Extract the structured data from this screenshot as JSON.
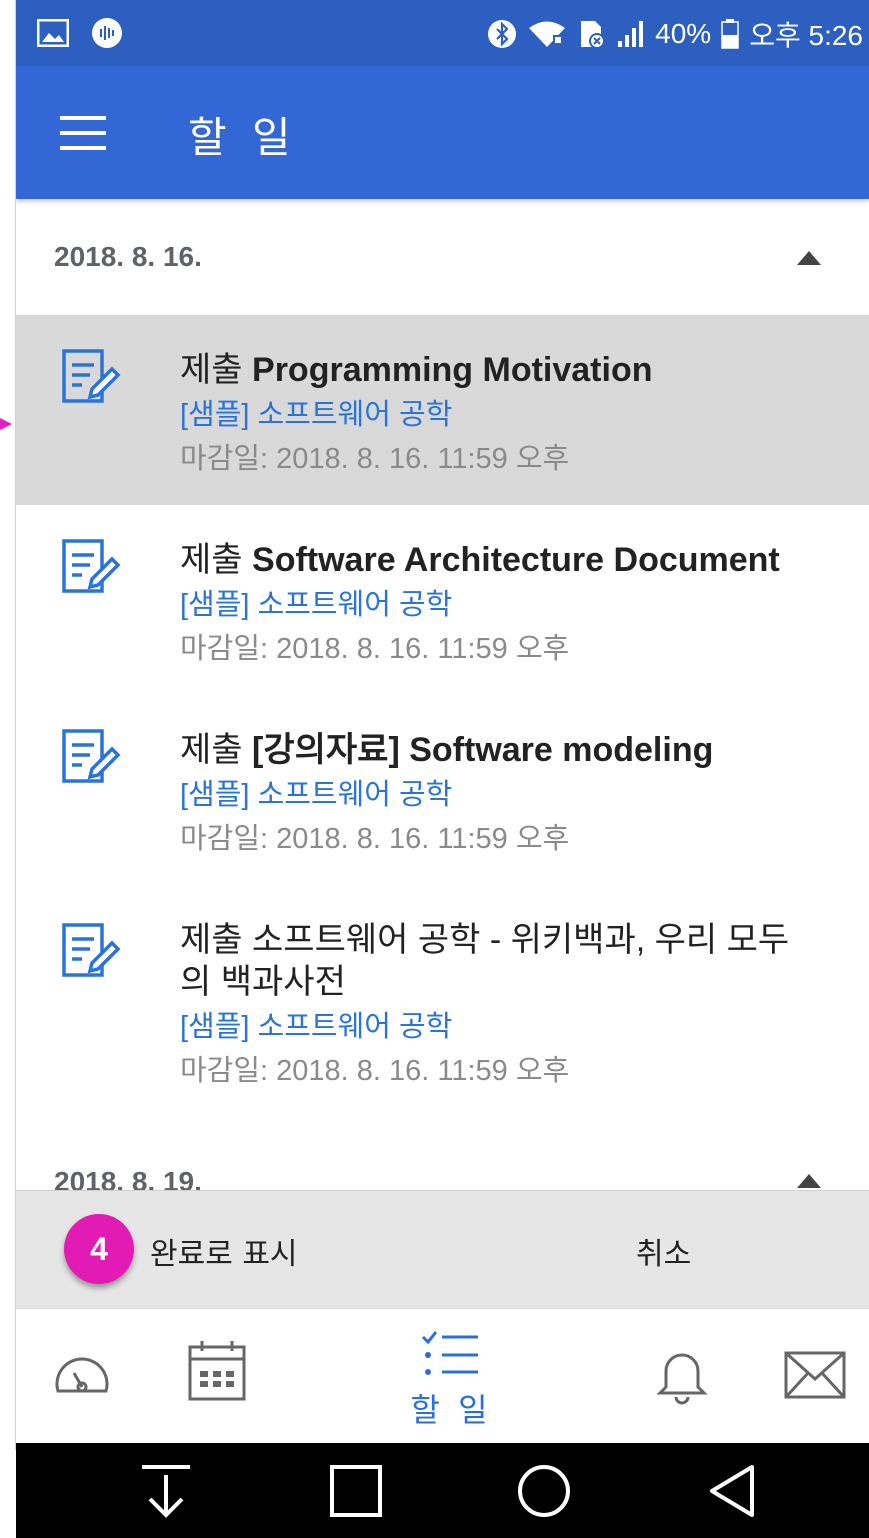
{
  "status_bar": {
    "battery": "40%",
    "time": "오후 5:26"
  },
  "app_bar": {
    "title": "할 일"
  },
  "groups": [
    {
      "date": "2018. 8. 16.",
      "items": [
        {
          "kind": "제출",
          "title": "Programming Motivation",
          "course": "[샘플] 소프트웨어 공학",
          "due": "마감일: 2018. 8. 16. 11:59 오후",
          "selected": true
        },
        {
          "kind": "제출",
          "title": "Software Architecture Document",
          "course": "[샘플] 소프트웨어 공학",
          "due": "마감일: 2018. 8. 16. 11:59 오후",
          "selected": false
        },
        {
          "kind": "제출",
          "title": "[강의자료] Software modeling",
          "course": "[샘플] 소프트웨어 공학",
          "due": "마감일: 2018. 8. 16. 11:59 오후",
          "selected": false
        },
        {
          "kind": "제출 소프트웨어 공학 - 위키백과, 우리 모두의 백과사전",
          "title": "",
          "course": "[샘플] 소프트웨어 공학",
          "due": "마감일: 2018. 8. 16. 11:59 오후",
          "selected": false
        }
      ]
    },
    {
      "date": "2018. 8. 19.",
      "items": []
    }
  ],
  "action_bar": {
    "badge": "4",
    "mark_complete": "완료로 표시",
    "cancel": "취소"
  },
  "bottom_nav": {
    "active_label": "할 일",
    "items": [
      "dashboard-icon",
      "calendar-icon",
      "todo-icon",
      "notifications-icon",
      "inbox-icon"
    ]
  },
  "colors": {
    "status_bar": "#2d5fc1",
    "app_bar": "#3367d6",
    "accent_blue": "#2a74d8",
    "badge": "#e31bb5",
    "selected_row": "#d9d9d9"
  }
}
